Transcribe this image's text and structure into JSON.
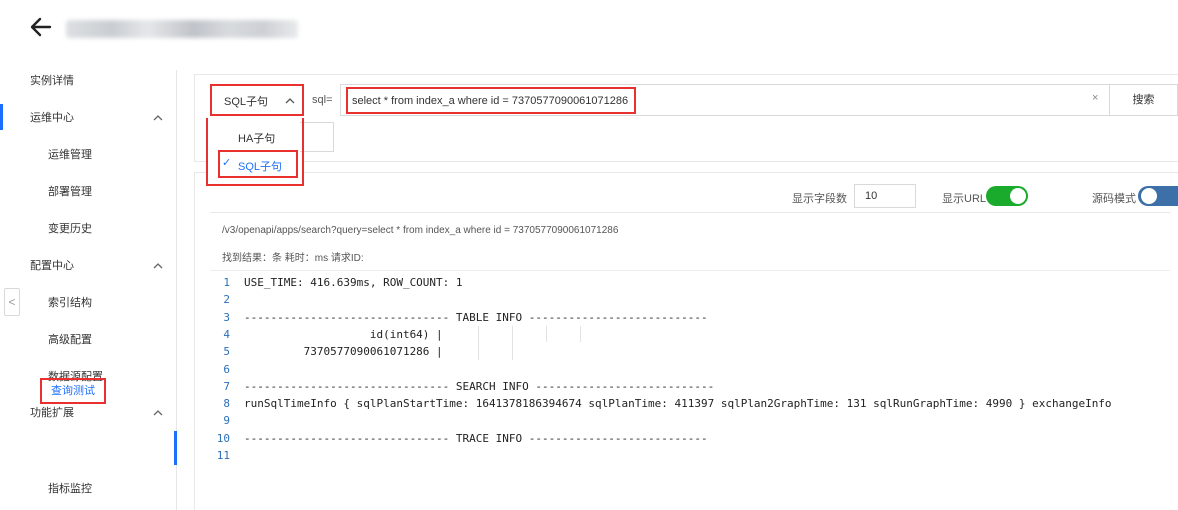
{
  "header": {
    "back_icon": "arrow-left-icon"
  },
  "sidebar": {
    "groups": [
      {
        "label": "实例详情"
      },
      {
        "label": "运维中心",
        "items": [
          "运维管理",
          "部署管理",
          "变更历史"
        ]
      },
      {
        "label": "配置中心",
        "items": [
          "索引结构",
          "高级配置",
          "数据源配置"
        ]
      },
      {
        "label": "功能扩展",
        "items": [
          "查询测试",
          "指标监控"
        ]
      }
    ],
    "active_item": "查询测试",
    "collapse_glyph": "<"
  },
  "query": {
    "select_value": "SQL子句",
    "sql_label": "sql=",
    "input_value": "select * from index_a where id = 7370577090061071286",
    "clear_glyph": "×",
    "search_label": "搜索",
    "dropdown_options": [
      "HA子句",
      "SQL子句"
    ],
    "check_glyph": "✓"
  },
  "options": {
    "field_count_label": "显示字段数",
    "field_count_value": "10",
    "show_url_label": "显示URL",
    "show_url_on": true,
    "source_mode_label": "源码模式",
    "source_mode_on": false
  },
  "result": {
    "url": "/v3/openapi/apps/search?query=select * from index_a where id = 7370577090061071286",
    "meta": "找到结果：条  耗时：ms  请求ID:",
    "lines": [
      {
        "n": "1",
        "text": "USE_TIME: 416.639ms, ROW_COUNT: 1"
      },
      {
        "n": "2",
        "text": ""
      },
      {
        "n": "3",
        "text": "------------------------------- TABLE INFO ---------------------------"
      },
      {
        "n": "4",
        "text": "                   id(int64) |"
      },
      {
        "n": "5",
        "text": "         7370577090061071286 |"
      },
      {
        "n": "6",
        "text": ""
      },
      {
        "n": "7",
        "text": "------------------------------- SEARCH INFO ---------------------------"
      },
      {
        "n": "8",
        "text": "runSqlTimeInfo { sqlPlanStartTime: 1641378186394674 sqlPlanTime: 411397 sqlPlan2GraphTime: 131 sqlRunGraphTime: 4990 } exchangeInfo"
      },
      {
        "n": "9",
        "text": ""
      },
      {
        "n": "10",
        "text": "------------------------------- TRACE INFO ---------------------------"
      },
      {
        "n": "11",
        "text": ""
      }
    ]
  },
  "colors": {
    "accent": "#1e6fff",
    "highlight": "#e8312f",
    "toggle_on": "#1aaa2c",
    "toggle_off": "#3d6fa8"
  }
}
